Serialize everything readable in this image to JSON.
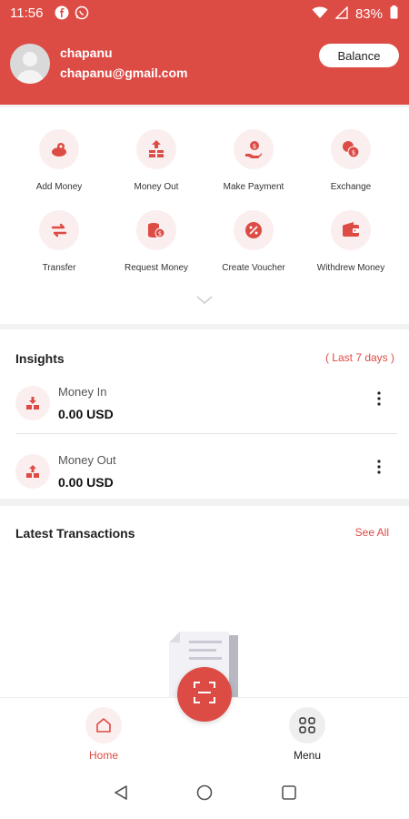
{
  "status_bar": {
    "time": "11:56",
    "battery": "83%"
  },
  "profile": {
    "name": "chapanu",
    "email": "chapanu@gmail.com",
    "balance_label": "Balance"
  },
  "actions": [
    {
      "label": "Add Money",
      "icon": "add-money-icon"
    },
    {
      "label": "Money Out",
      "icon": "money-out-icon"
    },
    {
      "label": "Make Payment",
      "icon": "make-payment-icon"
    },
    {
      "label": "Exchange",
      "icon": "exchange-icon"
    },
    {
      "label": "Transfer",
      "icon": "transfer-icon"
    },
    {
      "label": "Request Money",
      "icon": "request-money-icon"
    },
    {
      "label": "Create Voucher",
      "icon": "voucher-icon"
    },
    {
      "label": "Withdrew Money",
      "icon": "wallet-icon"
    }
  ],
  "insights": {
    "title": "Insights",
    "range": "( Last 7 days )",
    "items": [
      {
        "label": "Money In",
        "value": "0.00 USD"
      },
      {
        "label": "Money Out",
        "value": "0.00 USD"
      }
    ]
  },
  "latest": {
    "title": "Latest Transactions",
    "see_all": "See All"
  },
  "bottom_nav": {
    "home": "Home",
    "menu": "Menu"
  },
  "colors": {
    "accent": "#dd4b45",
    "accent_light": "#fbeeee"
  }
}
